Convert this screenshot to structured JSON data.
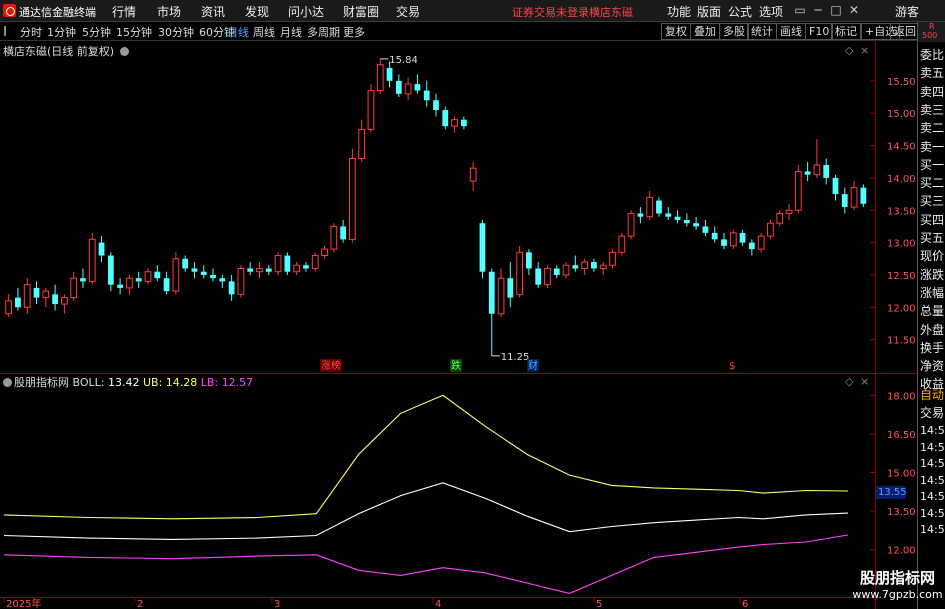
{
  "app": {
    "title": "通达信金融终端",
    "menu": [
      "行情",
      "市场",
      "资讯",
      "发现",
      "问小达",
      "财富圈",
      "交易"
    ],
    "login_status": "证券交易未登录",
    "stock_name": "横店东磁",
    "right_menu": [
      "功能",
      "版面",
      "公式",
      "选项"
    ],
    "guest": "游客"
  },
  "toolbar": {
    "periods": [
      "分时",
      "1分钟",
      "5分钟",
      "15分钟",
      "30分钟",
      "60分钟",
      "日线",
      "周线",
      "月线",
      "多周期",
      "更多"
    ],
    "active_period": "日线",
    "tools": [
      "复权",
      "叠加",
      "多股",
      "统计",
      "画线",
      "F10",
      "标记",
      "+自选",
      "返回"
    ]
  },
  "chart": {
    "title": "横店东磁(日线 前复权)",
    "high_label": "15.84",
    "low_label": "11.25",
    "events": [
      "涨榜",
      "跌",
      "财",
      "$"
    ],
    "y_ticks": [
      "15.50",
      "15.00",
      "14.50",
      "14.00",
      "13.50",
      "13.00",
      "12.50",
      "12.00",
      "11.50"
    ]
  },
  "indicator": {
    "name": "股朋指标网",
    "boll_label": "BOLL:",
    "boll": "13.42",
    "ub_label": "UB:",
    "ub": "14.28",
    "lb_label": "LB:",
    "lb": "12.57",
    "y_ticks": [
      "18.00",
      "16.50",
      "15.00",
      "13.50",
      "12.00"
    ],
    "current_price": "13.55",
    "colors": {
      "boll": "#ffffff",
      "ub": "#ffff66",
      "lb": "#ff44ff"
    }
  },
  "x_axis": [
    "2025年",
    "2",
    "3",
    "4",
    "5",
    "6"
  ],
  "sidepanel": {
    "r_label": "R",
    "r_num": "500",
    "labels": [
      "委比",
      "卖五",
      "卖四",
      "卖三",
      "卖二",
      "卖一",
      "买一",
      "买二",
      "买三",
      "买四",
      "买五",
      "现价",
      "涨跌",
      "涨幅",
      "总量",
      "外盘",
      "换手",
      "净资",
      "收益"
    ],
    "lower_labels": [
      "自动",
      "交易"
    ],
    "repeated_tick": "14:56"
  },
  "watermark": {
    "line1": "股朋指标网",
    "line2": "www.7gpzb.com"
  },
  "chart_data": {
    "type": "candlestick",
    "y_range": [
      11.0,
      15.9
    ],
    "candles": [
      {
        "o": 11.9,
        "h": 12.2,
        "l": 11.85,
        "c": 12.1
      },
      {
        "o": 12.15,
        "h": 12.3,
        "l": 11.95,
        "c": 12.0
      },
      {
        "o": 12.0,
        "h": 12.45,
        "l": 11.9,
        "c": 12.35
      },
      {
        "o": 12.3,
        "h": 12.4,
        "l": 12.05,
        "c": 12.15
      },
      {
        "o": 12.15,
        "h": 12.3,
        "l": 12.0,
        "c": 12.25
      },
      {
        "o": 12.2,
        "h": 12.35,
        "l": 11.95,
        "c": 12.05
      },
      {
        "o": 12.05,
        "h": 12.2,
        "l": 11.9,
        "c": 12.15
      },
      {
        "o": 12.15,
        "h": 12.55,
        "l": 12.1,
        "c": 12.45
      },
      {
        "o": 12.45,
        "h": 12.6,
        "l": 12.3,
        "c": 12.4
      },
      {
        "o": 12.4,
        "h": 13.15,
        "l": 12.35,
        "c": 13.05
      },
      {
        "o": 13.0,
        "h": 13.1,
        "l": 12.7,
        "c": 12.8
      },
      {
        "o": 12.8,
        "h": 12.85,
        "l": 12.25,
        "c": 12.35
      },
      {
        "o": 12.35,
        "h": 12.45,
        "l": 12.2,
        "c": 12.3
      },
      {
        "o": 12.3,
        "h": 12.5,
        "l": 12.2,
        "c": 12.45
      },
      {
        "o": 12.45,
        "h": 12.55,
        "l": 12.3,
        "c": 12.4
      },
      {
        "o": 12.4,
        "h": 12.6,
        "l": 12.35,
        "c": 12.55
      },
      {
        "o": 12.55,
        "h": 12.65,
        "l": 12.4,
        "c": 12.45
      },
      {
        "o": 12.45,
        "h": 12.55,
        "l": 12.2,
        "c": 12.25
      },
      {
        "o": 12.25,
        "h": 12.85,
        "l": 12.2,
        "c": 12.75
      },
      {
        "o": 12.75,
        "h": 12.8,
        "l": 12.55,
        "c": 12.6
      },
      {
        "o": 12.6,
        "h": 12.7,
        "l": 12.45,
        "c": 12.55
      },
      {
        "o": 12.55,
        "h": 12.65,
        "l": 12.45,
        "c": 12.5
      },
      {
        "o": 12.5,
        "h": 12.6,
        "l": 12.4,
        "c": 12.45
      },
      {
        "o": 12.45,
        "h": 12.5,
        "l": 12.3,
        "c": 12.4
      },
      {
        "o": 12.4,
        "h": 12.5,
        "l": 12.1,
        "c": 12.2
      },
      {
        "o": 12.2,
        "h": 12.65,
        "l": 12.15,
        "c": 12.6
      },
      {
        "o": 12.6,
        "h": 12.7,
        "l": 12.5,
        "c": 12.55
      },
      {
        "o": 12.55,
        "h": 12.7,
        "l": 12.45,
        "c": 12.6
      },
      {
        "o": 12.6,
        "h": 12.65,
        "l": 12.5,
        "c": 12.55
      },
      {
        "o": 12.55,
        "h": 12.85,
        "l": 12.5,
        "c": 12.8
      },
      {
        "o": 12.8,
        "h": 12.85,
        "l": 12.5,
        "c": 12.55
      },
      {
        "o": 12.55,
        "h": 12.7,
        "l": 12.5,
        "c": 12.65
      },
      {
        "o": 12.65,
        "h": 12.7,
        "l": 12.55,
        "c": 12.6
      },
      {
        "o": 12.6,
        "h": 12.85,
        "l": 12.55,
        "c": 12.8
      },
      {
        "o": 12.8,
        "h": 12.95,
        "l": 12.75,
        "c": 12.9
      },
      {
        "o": 12.9,
        "h": 13.3,
        "l": 12.85,
        "c": 13.25
      },
      {
        "o": 13.25,
        "h": 13.35,
        "l": 13.0,
        "c": 13.05
      },
      {
        "o": 13.05,
        "h": 14.45,
        "l": 13.0,
        "c": 14.3
      },
      {
        "o": 14.3,
        "h": 14.9,
        "l": 14.25,
        "c": 14.75
      },
      {
        "o": 14.75,
        "h": 15.45,
        "l": 14.7,
        "c": 15.35
      },
      {
        "o": 15.35,
        "h": 15.84,
        "l": 15.3,
        "c": 15.75
      },
      {
        "o": 15.7,
        "h": 15.8,
        "l": 15.4,
        "c": 15.5
      },
      {
        "o": 15.5,
        "h": 15.6,
        "l": 15.25,
        "c": 15.3
      },
      {
        "o": 15.3,
        "h": 15.55,
        "l": 15.2,
        "c": 15.45
      },
      {
        "o": 15.45,
        "h": 15.6,
        "l": 15.3,
        "c": 15.35
      },
      {
        "o": 15.35,
        "h": 15.5,
        "l": 15.1,
        "c": 15.2
      },
      {
        "o": 15.2,
        "h": 15.3,
        "l": 14.95,
        "c": 15.05
      },
      {
        "o": 15.05,
        "h": 15.1,
        "l": 14.75,
        "c": 14.8
      },
      {
        "o": 14.8,
        "h": 14.95,
        "l": 14.7,
        "c": 14.9
      },
      {
        "o": 14.9,
        "h": 14.95,
        "l": 14.75,
        "c": 14.8
      },
      {
        "o": 13.95,
        "h": 14.25,
        "l": 13.8,
        "c": 14.15
      },
      {
        "o": 13.3,
        "h": 13.35,
        "l": 12.45,
        "c": 12.55
      },
      {
        "o": 12.55,
        "h": 12.6,
        "l": 11.25,
        "c": 11.9
      },
      {
        "o": 11.9,
        "h": 12.6,
        "l": 11.85,
        "c": 12.45
      },
      {
        "o": 12.45,
        "h": 12.7,
        "l": 12.0,
        "c": 12.15
      },
      {
        "o": 12.2,
        "h": 12.95,
        "l": 12.15,
        "c": 12.85
      },
      {
        "o": 12.85,
        "h": 12.9,
        "l": 12.5,
        "c": 12.6
      },
      {
        "o": 12.6,
        "h": 12.7,
        "l": 12.3,
        "c": 12.35
      },
      {
        "o": 12.35,
        "h": 12.65,
        "l": 12.3,
        "c": 12.6
      },
      {
        "o": 12.6,
        "h": 12.65,
        "l": 12.45,
        "c": 12.5
      },
      {
        "o": 12.5,
        "h": 12.7,
        "l": 12.45,
        "c": 12.65
      },
      {
        "o": 12.65,
        "h": 12.8,
        "l": 12.55,
        "c": 12.6
      },
      {
        "o": 12.6,
        "h": 12.75,
        "l": 12.5,
        "c": 12.7
      },
      {
        "o": 12.7,
        "h": 12.75,
        "l": 12.55,
        "c": 12.6
      },
      {
        "o": 12.6,
        "h": 12.7,
        "l": 12.5,
        "c": 12.65
      },
      {
        "o": 12.65,
        "h": 12.9,
        "l": 12.6,
        "c": 12.85
      },
      {
        "o": 12.85,
        "h": 13.15,
        "l": 12.8,
        "c": 13.1
      },
      {
        "o": 13.1,
        "h": 13.5,
        "l": 13.05,
        "c": 13.45
      },
      {
        "o": 13.45,
        "h": 13.55,
        "l": 13.3,
        "c": 13.4
      },
      {
        "o": 13.4,
        "h": 13.8,
        "l": 13.35,
        "c": 13.7
      },
      {
        "o": 13.65,
        "h": 13.7,
        "l": 13.4,
        "c": 13.45
      },
      {
        "o": 13.45,
        "h": 13.55,
        "l": 13.35,
        "c": 13.4
      },
      {
        "o": 13.4,
        "h": 13.5,
        "l": 13.3,
        "c": 13.35
      },
      {
        "o": 13.35,
        "h": 13.45,
        "l": 13.25,
        "c": 13.3
      },
      {
        "o": 13.3,
        "h": 13.4,
        "l": 13.2,
        "c": 13.25
      },
      {
        "o": 13.25,
        "h": 13.35,
        "l": 13.1,
        "c": 13.15
      },
      {
        "o": 13.15,
        "h": 13.25,
        "l": 13.0,
        "c": 13.05
      },
      {
        "o": 13.05,
        "h": 13.15,
        "l": 12.9,
        "c": 12.95
      },
      {
        "o": 12.95,
        "h": 13.2,
        "l": 12.9,
        "c": 13.15
      },
      {
        "o": 13.15,
        "h": 13.2,
        "l": 12.95,
        "c": 13.0
      },
      {
        "o": 13.0,
        "h": 13.05,
        "l": 12.8,
        "c": 12.9
      },
      {
        "o": 12.9,
        "h": 13.15,
        "l": 12.85,
        "c": 13.1
      },
      {
        "o": 13.1,
        "h": 13.35,
        "l": 13.05,
        "c": 13.3
      },
      {
        "o": 13.3,
        "h": 13.5,
        "l": 13.25,
        "c": 13.45
      },
      {
        "o": 13.45,
        "h": 13.6,
        "l": 13.35,
        "c": 13.5
      },
      {
        "o": 13.5,
        "h": 14.2,
        "l": 13.45,
        "c": 14.1
      },
      {
        "o": 14.1,
        "h": 14.25,
        "l": 13.95,
        "c": 14.05
      },
      {
        "o": 14.05,
        "h": 14.6,
        "l": 14.0,
        "c": 14.2
      },
      {
        "o": 14.2,
        "h": 14.3,
        "l": 13.9,
        "c": 14.0
      },
      {
        "o": 14.0,
        "h": 14.05,
        "l": 13.65,
        "c": 13.75
      },
      {
        "o": 13.75,
        "h": 13.85,
        "l": 13.45,
        "c": 13.55
      },
      {
        "o": 13.55,
        "h": 13.95,
        "l": 13.5,
        "c": 13.85
      },
      {
        "o": 13.85,
        "h": 13.9,
        "l": 13.55,
        "c": 13.6
      }
    ],
    "boll": {
      "x_frac": [
        0.0,
        0.1,
        0.2,
        0.3,
        0.37,
        0.42,
        0.47,
        0.52,
        0.57,
        0.62,
        0.67,
        0.72,
        0.77,
        0.82,
        0.87,
        0.9,
        0.95,
        1.0
      ],
      "mid": [
        12.55,
        12.45,
        12.4,
        12.45,
        12.55,
        13.4,
        14.1,
        14.6,
        14.0,
        13.3,
        12.7,
        12.9,
        13.05,
        13.15,
        13.25,
        13.2,
        13.35,
        13.42
      ],
      "ub": [
        13.35,
        13.25,
        13.2,
        13.25,
        13.4,
        15.7,
        17.3,
        18.0,
        16.8,
        15.7,
        14.9,
        14.5,
        14.4,
        14.35,
        14.3,
        14.2,
        14.3,
        14.28
      ],
      "lb": [
        11.8,
        11.7,
        11.65,
        11.75,
        11.8,
        11.2,
        11.0,
        11.3,
        11.1,
        10.7,
        10.3,
        11.0,
        11.7,
        11.9,
        12.1,
        12.2,
        12.3,
        12.57
      ],
      "y_range": [
        10.2,
        18.4
      ]
    }
  }
}
